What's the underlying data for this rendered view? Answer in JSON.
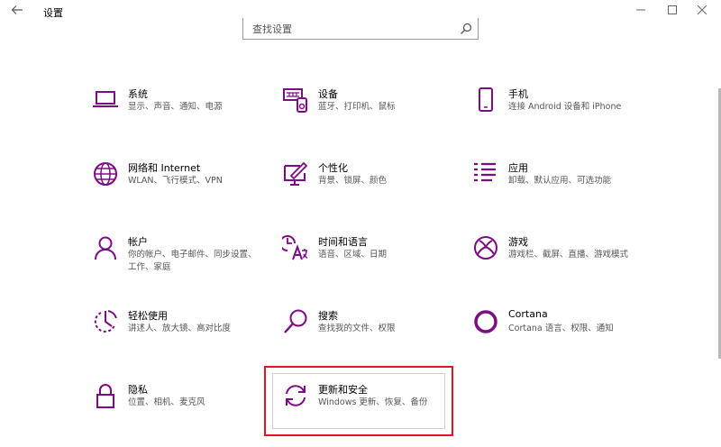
{
  "window": {
    "title": "设置"
  },
  "search": {
    "placeholder": "查找设置"
  },
  "colors": {
    "accent": "#7e0b86",
    "highlight": "#e0171e"
  },
  "tiles": [
    {
      "title": "系统",
      "desc": "显示、声音、通知、电源",
      "icon": "laptop-icon"
    },
    {
      "title": "设备",
      "desc": "蓝牙、打印机、鼠标",
      "icon": "devices-icon"
    },
    {
      "title": "手机",
      "desc": "连接 Android 设备和 iPhone",
      "icon": "phone-icon"
    },
    {
      "title": "网络和 Internet",
      "desc": "WLAN、飞行模式、VPN",
      "icon": "globe-icon"
    },
    {
      "title": "个性化",
      "desc": "背景、锁屏、颜色",
      "icon": "personalization-icon"
    },
    {
      "title": "应用",
      "desc": "卸载、默认应用、可选功能",
      "icon": "apps-icon"
    },
    {
      "title": "帐户",
      "desc": "你的帐户、电子邮件、同步设置、工作、家庭",
      "icon": "person-icon"
    },
    {
      "title": "时间和语言",
      "desc": "语音、区域、日期",
      "icon": "time-language-icon"
    },
    {
      "title": "游戏",
      "desc": "游戏栏、截屏、直播、游戏模式",
      "icon": "xbox-icon"
    },
    {
      "title": "轻松使用",
      "desc": "讲述人、放大镜、高对比度",
      "icon": "ease-of-access-icon"
    },
    {
      "title": "搜索",
      "desc": "查找我的文件、权限",
      "icon": "search-icon"
    },
    {
      "title": "Cortana",
      "desc": "Cortana 语言、权限、通知",
      "icon": "cortana-icon"
    },
    {
      "title": "隐私",
      "desc": "位置、相机、麦克风",
      "icon": "lock-icon"
    },
    {
      "title": "更新和安全",
      "desc": "Windows 更新、恢复、备份",
      "icon": "update-icon"
    }
  ]
}
